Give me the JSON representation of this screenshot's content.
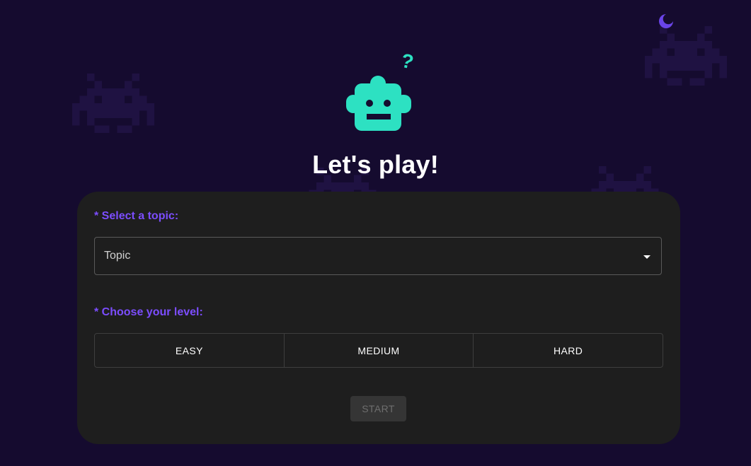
{
  "title": "Let's play!",
  "colors": {
    "background": "#150b2f",
    "card": "#1e1e1e",
    "accent": "#7c4dff",
    "robot": "#2de1c2",
    "invader": "#1f1242"
  },
  "icons": {
    "robot": "robot-icon",
    "question": "question-mark-icon",
    "theme_toggle": "moon-icon",
    "caret": "caret-down-icon",
    "decoration": "space-invader-icon"
  },
  "form": {
    "topic_label": "* Select a topic:",
    "topic_select": {
      "placeholder": "Topic"
    },
    "level_label": "* Choose your level:",
    "levels": [
      "EASY",
      "MEDIUM",
      "HARD"
    ],
    "start_label": "START",
    "start_disabled": true
  }
}
